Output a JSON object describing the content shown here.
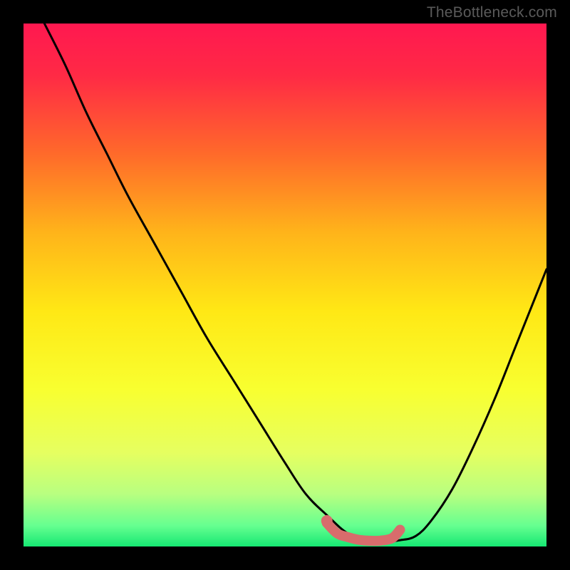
{
  "watermark": "TheBottleneck.com",
  "chart_data": {
    "type": "line",
    "title": "",
    "xlabel": "",
    "ylabel": "",
    "xlim": [
      0,
      100
    ],
    "ylim": [
      0,
      100
    ],
    "gradient_stops": [
      {
        "offset": 0,
        "color": "#ff1850"
      },
      {
        "offset": 10,
        "color": "#ff2a45"
      },
      {
        "offset": 25,
        "color": "#ff6a2a"
      },
      {
        "offset": 40,
        "color": "#ffb41a"
      },
      {
        "offset": 55,
        "color": "#ffe815"
      },
      {
        "offset": 70,
        "color": "#f8ff30"
      },
      {
        "offset": 82,
        "color": "#e6ff60"
      },
      {
        "offset": 90,
        "color": "#b8ff80"
      },
      {
        "offset": 96,
        "color": "#66ff90"
      },
      {
        "offset": 100,
        "color": "#16e873"
      }
    ],
    "series": [
      {
        "name": "bottleneck-curve",
        "color": "#000000",
        "x": [
          4,
          8,
          12,
          16,
          20,
          25,
          30,
          35,
          40,
          45,
          50,
          54,
          58,
          62,
          66,
          70,
          72,
          75,
          78,
          82,
          86,
          90,
          94,
          98,
          100
        ],
        "y": [
          100,
          92,
          83,
          75,
          67,
          58,
          49,
          40,
          32,
          24,
          16,
          10,
          6,
          2.5,
          1,
          1,
          1.2,
          2,
          5,
          11,
          19,
          28,
          38,
          48,
          53
        ]
      },
      {
        "name": "optimal-highlight",
        "color": "#d86c6c",
        "x": [
          58,
          60,
          62,
          64,
          66,
          68,
          70,
          71,
          72
        ],
        "y": [
          4.5,
          2.5,
          1.8,
          1.3,
          1.1,
          1.1,
          1.4,
          2.0,
          3.2
        ]
      }
    ],
    "annotations": []
  }
}
